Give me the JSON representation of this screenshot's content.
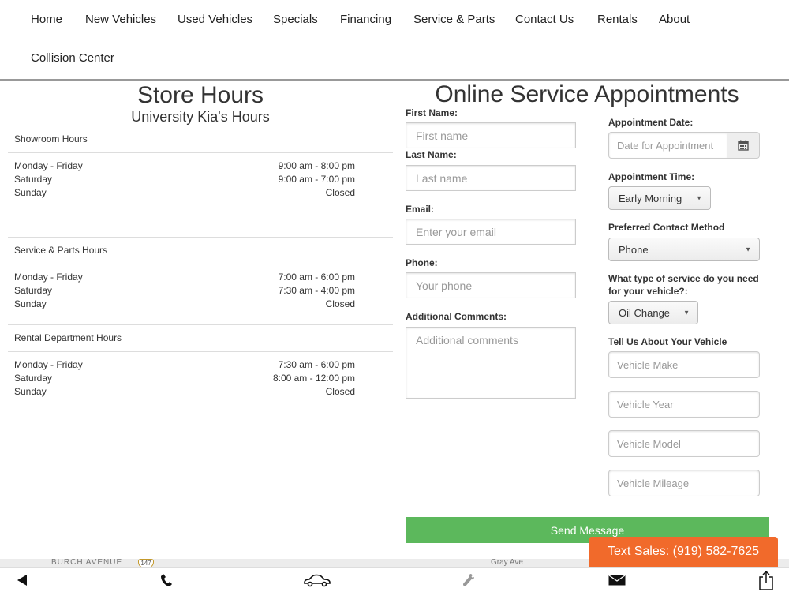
{
  "nav": {
    "items": [
      "Home",
      "New Vehicles",
      "Used Vehicles",
      "Specials",
      "Financing",
      "Service & Parts",
      "Contact Us",
      "Rentals",
      "About",
      "Collision Center"
    ]
  },
  "store_hours": {
    "title": "Store Hours",
    "subtitle": "University Kia's Hours",
    "sections": [
      {
        "title": "Showroom Hours",
        "rows": [
          {
            "day": "Monday - Friday",
            "time": "9:00 am - 8:00 pm"
          },
          {
            "day": "Saturday",
            "time": "9:00 am - 7:00 pm"
          },
          {
            "day": "Sunday",
            "time": "Closed"
          }
        ]
      },
      {
        "title": "Service & Parts Hours",
        "rows": [
          {
            "day": "Monday - Friday",
            "time": "7:00 am - 6:00 pm"
          },
          {
            "day": "Saturday",
            "time": "7:30 am - 4:00 pm"
          },
          {
            "day": "Sunday",
            "time": "Closed"
          }
        ]
      },
      {
        "title": "Rental Department Hours",
        "rows": [
          {
            "day": "Monday - Friday",
            "time": "7:30 am - 6:00 pm"
          },
          {
            "day": "Saturday",
            "time": "8:00 am - 12:00 pm"
          },
          {
            "day": "Sunday",
            "time": "Closed"
          }
        ]
      }
    ]
  },
  "form": {
    "title": "Online Service Appointments",
    "first_name_label": "First Name:",
    "first_name_placeholder": "First name",
    "last_name_label": "Last Name:",
    "last_name_placeholder": "Last name",
    "email_label": "Email:",
    "email_placeholder": "Enter your email",
    "phone_label": "Phone:",
    "phone_placeholder": "Your phone",
    "comments_label": "Additional Comments:",
    "comments_placeholder": "Additional comments",
    "date_label": "Appointment Date:",
    "date_placeholder": "Date for Appointment",
    "time_label": "Appointment Time:",
    "time_value": "Early Morning",
    "contact_label": "Preferred Contact Method",
    "contact_value": "Phone",
    "service_label_1": "What type of service do you need",
    "service_label_2": "for your vehicle?:",
    "service_value": "Oil Change",
    "vehicle_label": "Tell Us About Your Vehicle",
    "make_placeholder": "Vehicle Make",
    "year_placeholder": "Vehicle Year",
    "model_placeholder": "Vehicle Model",
    "mileage_placeholder": "Vehicle Mileage",
    "submit_label": "Send Message"
  },
  "map": {
    "road1": "BURCH AVENUE",
    "road2": "Gray Ave",
    "shield": "147"
  },
  "text_sales": "Text Sales: (919) 582-7625",
  "toolbar": {
    "icons": [
      "back-arrow-icon",
      "phone-icon",
      "car-icon",
      "wrench-icon",
      "mail-icon",
      "share-icon"
    ]
  },
  "colors": {
    "submit": "#5cb85c",
    "text_sales": "#f16a2b"
  }
}
